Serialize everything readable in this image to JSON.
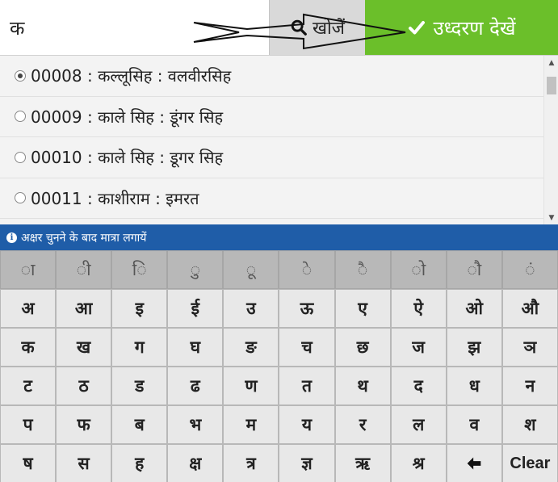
{
  "search": {
    "value": "क",
    "button_label": "खोजें",
    "view_button_label": "उध्दरण देखें"
  },
  "results": [
    {
      "label": "00008 : कल्लूसिह : वलवीरसिह",
      "checked": true
    },
    {
      "label": "00009 : काले सिह : डूंगर सिह",
      "checked": false
    },
    {
      "label": "00010 : काले सिह : डूगर सिह",
      "checked": false
    },
    {
      "label": "00011 : काशीराम : इमरत",
      "checked": false
    }
  ],
  "info_bar": {
    "text": "अक्षर चुनने के बाद मात्रा लगायें"
  },
  "keyboard": {
    "matra_row": [
      "ा",
      "ी",
      "ि",
      "ु",
      "ू",
      "े",
      "ै",
      "ो",
      "ौ",
      "ं"
    ],
    "rows": [
      [
        "अ",
        "आ",
        "इ",
        "ई",
        "उ",
        "ऊ",
        "ए",
        "ऐ",
        "ओ",
        "औ"
      ],
      [
        "क",
        "ख",
        "ग",
        "घ",
        "ङ",
        "च",
        "छ",
        "ज",
        "झ",
        "ञ"
      ],
      [
        "ट",
        "ठ",
        "ड",
        "ढ",
        "ण",
        "त",
        "थ",
        "द",
        "ध",
        "न"
      ],
      [
        "प",
        "फ",
        "ब",
        "भ",
        "म",
        "य",
        "र",
        "ल",
        "व",
        "श"
      ],
      [
        "ष",
        "स",
        "ह",
        "क्ष",
        "त्र",
        "ज्ञ",
        "ऋ",
        "श्र",
        "",
        "Clear"
      ]
    ],
    "backspace_icon": "left-arrow-icon"
  },
  "colors": {
    "accent_green": "#6bbf2a",
    "info_blue": "#1f5da8",
    "matra_key": "#b8b8b8",
    "key": "#e8e8e8"
  }
}
